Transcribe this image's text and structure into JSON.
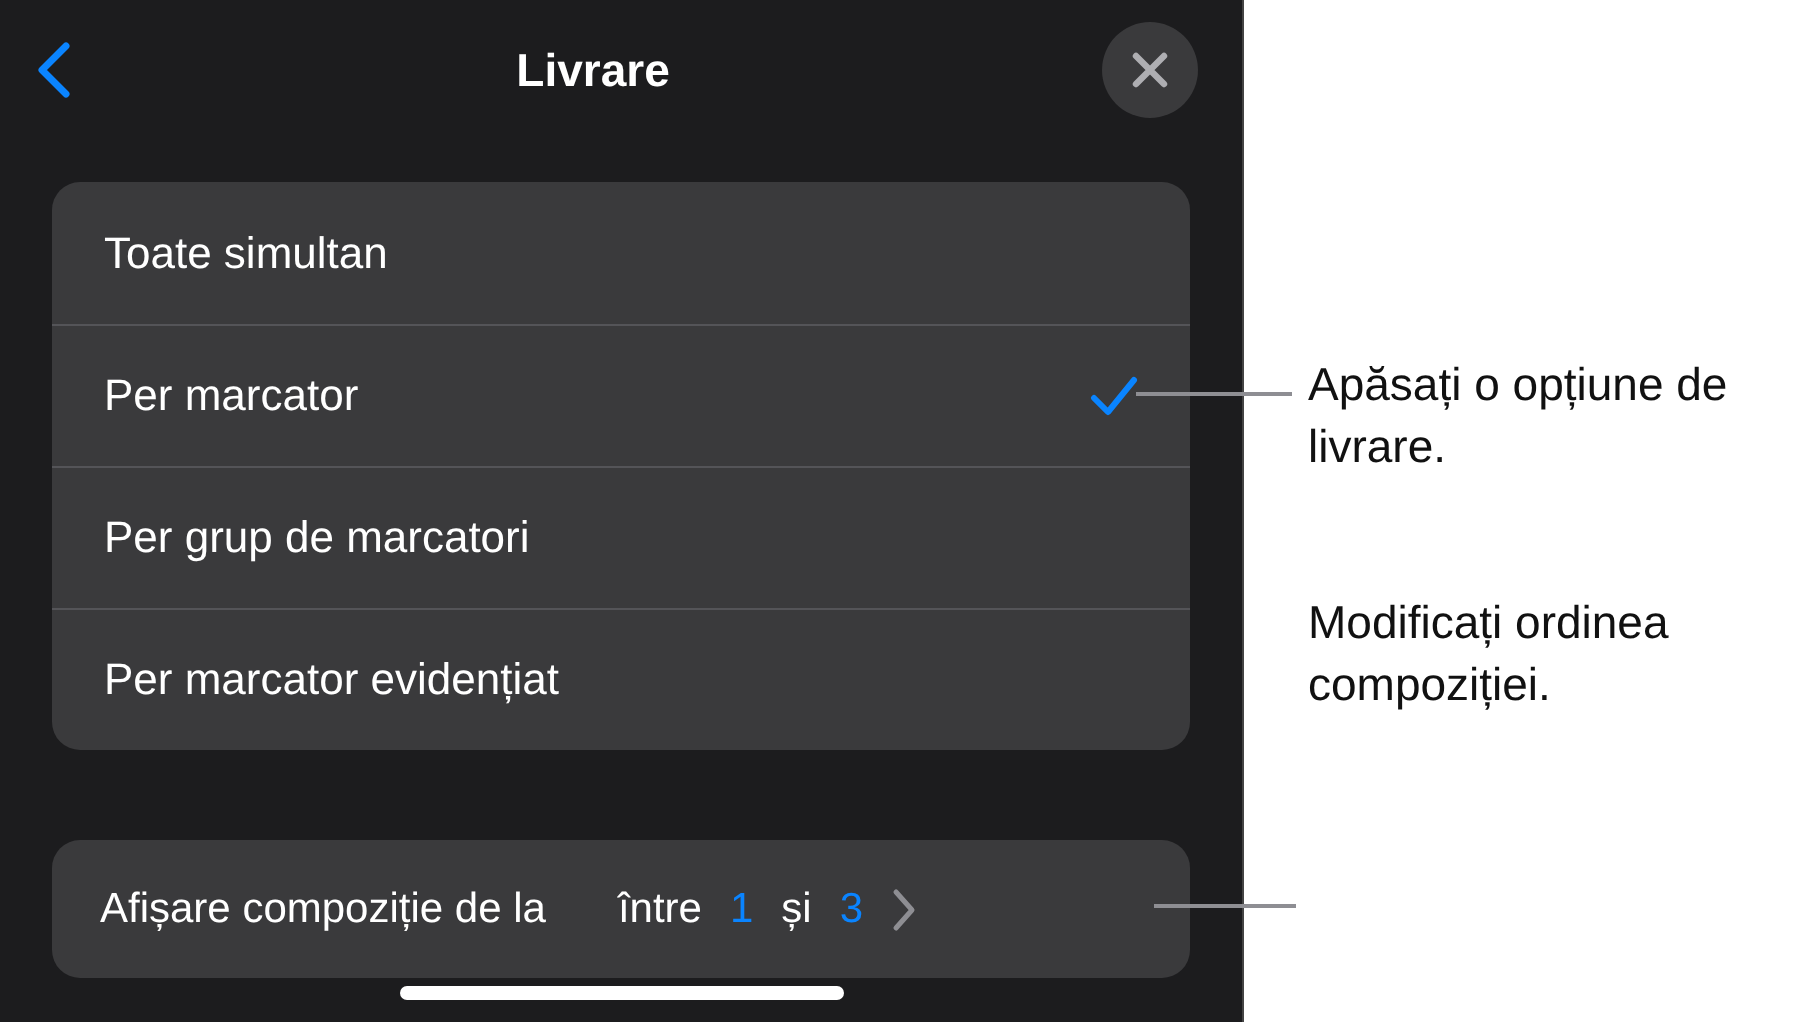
{
  "header": {
    "title": "Livrare"
  },
  "options": [
    {
      "label": "Toate simultan",
      "selected": false
    },
    {
      "label": "Per marcator",
      "selected": true
    },
    {
      "label": "Per grup de marcatori",
      "selected": false
    },
    {
      "label": "Per marcator evidențiat",
      "selected": false
    }
  ],
  "build_row": {
    "label": "Afișare compoziție de la",
    "between": "între",
    "from": "1",
    "and": "și",
    "to": "3"
  },
  "callouts": [
    "Apăsați o opțiune de livrare.",
    "Modificați ordinea compoziției."
  ]
}
